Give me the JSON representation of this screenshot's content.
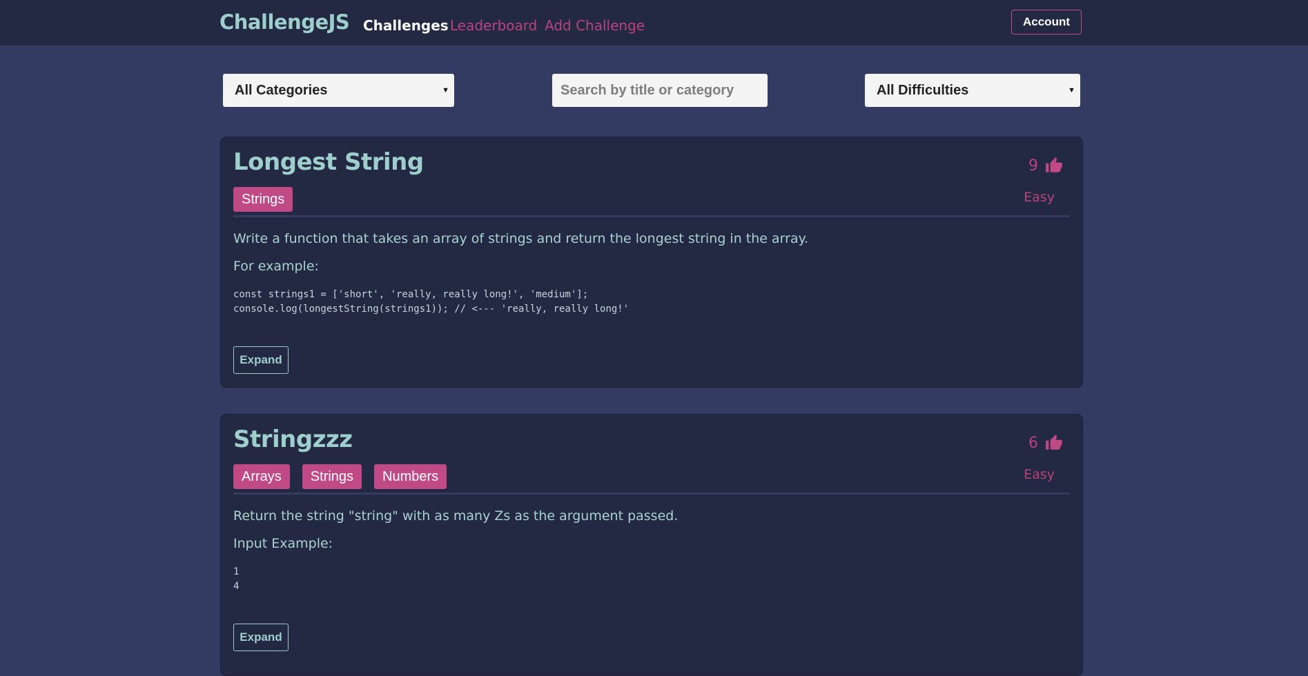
{
  "header": {
    "brand": "ChallengeJS",
    "nav": [
      {
        "label": "Challenges",
        "active": true
      },
      {
        "label": "Leaderboard",
        "active": false
      },
      {
        "label": "Add Challenge",
        "active": false
      }
    ],
    "account_label": "Account"
  },
  "filters": {
    "category_selected": "All Categories",
    "search_placeholder": "Search by title or category",
    "search_value": "",
    "difficulty_selected": "All Difficulties"
  },
  "challenges": [
    {
      "title": "Longest String",
      "tags": [
        "Strings"
      ],
      "votes": "9",
      "difficulty": "Easy",
      "description": "Write a function that takes an array of strings and return the longest string in the array.",
      "example_label": "For example:",
      "code": "const strings1 = ['short', 'really, really long!', 'medium'];\nconsole.log(longestString(strings1)); // <--- 'really, really long!'",
      "expand_label": "Expand"
    },
    {
      "title": "Stringzzz",
      "tags": [
        "Arrays",
        "Strings",
        "Numbers"
      ],
      "votes": "6",
      "difficulty": "Easy",
      "description": "Return the string \"string\" with as many Zs as the argument passed.",
      "example_label": "Input Example:",
      "code": "1\n4",
      "expand_label": "Expand"
    }
  ],
  "colors": {
    "page_bg": "#343b62",
    "header_bg": "#232843",
    "card_bg": "#232843",
    "accent_pink": "#c04a86",
    "teal_text": "#9fcfcd"
  },
  "icons": {
    "vote": "thumbs-up-icon",
    "dropdown": "caret-down-icon"
  }
}
